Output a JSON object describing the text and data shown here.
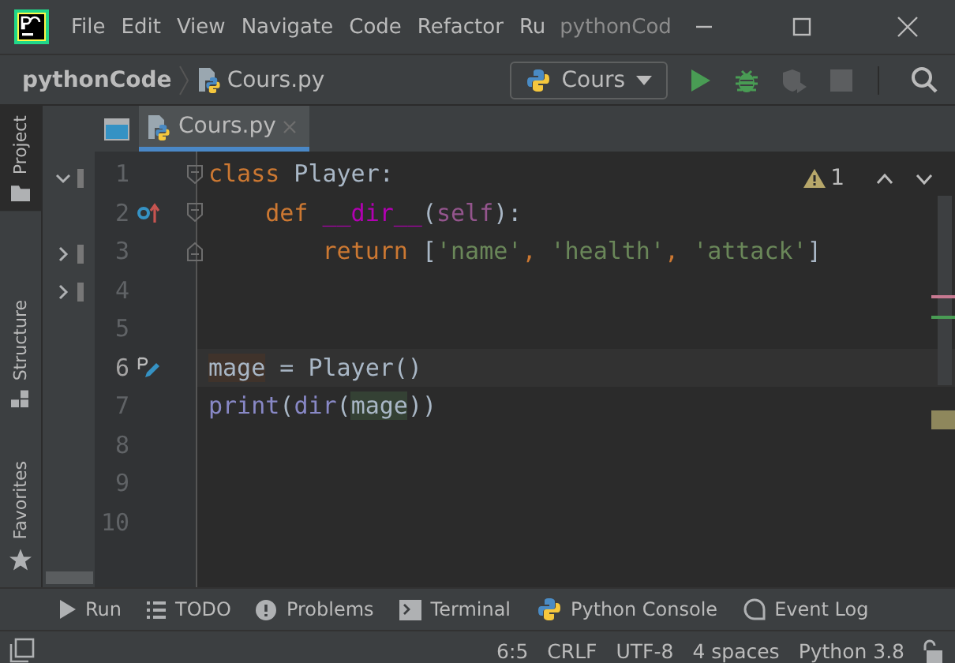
{
  "window": {
    "title": "pythonCod"
  },
  "menu": [
    "File",
    "Edit",
    "View",
    "Navigate",
    "Code",
    "Refactor",
    "Ru"
  ],
  "breadcrumb": {
    "project": "pythonCode",
    "file": "Cours.py"
  },
  "run_config": {
    "label": "Cours"
  },
  "side_tabs": [
    {
      "label": "Project",
      "kind": "project",
      "selected": true
    },
    {
      "label": "Structure",
      "kind": "structure",
      "selected": false
    },
    {
      "label": "Favorites",
      "kind": "favorites",
      "selected": false
    }
  ],
  "project_tree": [
    {
      "expanded": true
    },
    {
      "expanded": false
    },
    {
      "expanded": false
    }
  ],
  "editor_tabs": [
    {
      "label": "Cours.py",
      "selected": true
    }
  ],
  "inspections": {
    "warnings": "1"
  },
  "lines": [
    {
      "number": "1",
      "current": false,
      "fold": {
        "kind": "start"
      },
      "tokens": [
        {
          "text": "class",
          "kind": "keyword"
        },
        {
          "text": " Player:",
          "kind": "plain"
        }
      ]
    },
    {
      "number": "2",
      "current": false,
      "fold": {
        "kind": "start"
      },
      "marker": {
        "kind": "override"
      },
      "tokens": [
        {
          "text": "    def",
          "kind": "keyword"
        },
        {
          "text": " __dir__",
          "kind": "dunder"
        },
        {
          "text": "(",
          "kind": "plain"
        },
        {
          "text": "self",
          "kind": "self"
        },
        {
          "text": "):",
          "kind": "plain"
        }
      ]
    },
    {
      "number": "3",
      "current": false,
      "fold": {
        "kind": "end"
      },
      "tokens": [
        {
          "text": "        return",
          "kind": "keyword"
        },
        {
          "text": " [",
          "kind": "plain"
        },
        {
          "text": "'name'",
          "kind": "string"
        },
        {
          "text": ", ",
          "kind": "keyword"
        },
        {
          "text": "'health'",
          "kind": "string"
        },
        {
          "text": ", ",
          "kind": "keyword"
        },
        {
          "text": "'attack'",
          "kind": "string"
        },
        {
          "text": "]",
          "kind": "plain"
        }
      ]
    },
    {
      "number": "4",
      "current": false
    },
    {
      "number": "5",
      "current": false
    },
    {
      "number": "6",
      "current": true,
      "marker": {
        "kind": "rename"
      },
      "tokens": [
        {
          "text": "mage",
          "kind": "write"
        },
        {
          "text": " = Player()",
          "kind": "plain"
        }
      ]
    },
    {
      "number": "7",
      "current": false,
      "tokens": [
        {
          "text": "print",
          "kind": "builtin"
        },
        {
          "text": "(",
          "kind": "plain"
        },
        {
          "text": "dir",
          "kind": "builtin"
        },
        {
          "text": "(",
          "kind": "plain"
        },
        {
          "text": "mage",
          "kind": "read"
        },
        {
          "text": "))",
          "kind": "plain"
        }
      ]
    },
    {
      "number": "8",
      "current": false
    },
    {
      "number": "9",
      "current": false
    },
    {
      "number": "10",
      "current": false
    }
  ],
  "tool_windows": [
    {
      "label": "Run",
      "kind": "run"
    },
    {
      "label": "TODO",
      "kind": "todo"
    },
    {
      "label": "Problems",
      "kind": "problems"
    },
    {
      "label": "Terminal",
      "kind": "terminal"
    },
    {
      "label": "Python Console",
      "kind": "console"
    },
    {
      "label": "Event Log",
      "kind": "log"
    }
  ],
  "status_bar": [
    "6:5",
    "CRLF",
    "UTF-8",
    "4 spaces",
    "Python 3.8"
  ]
}
